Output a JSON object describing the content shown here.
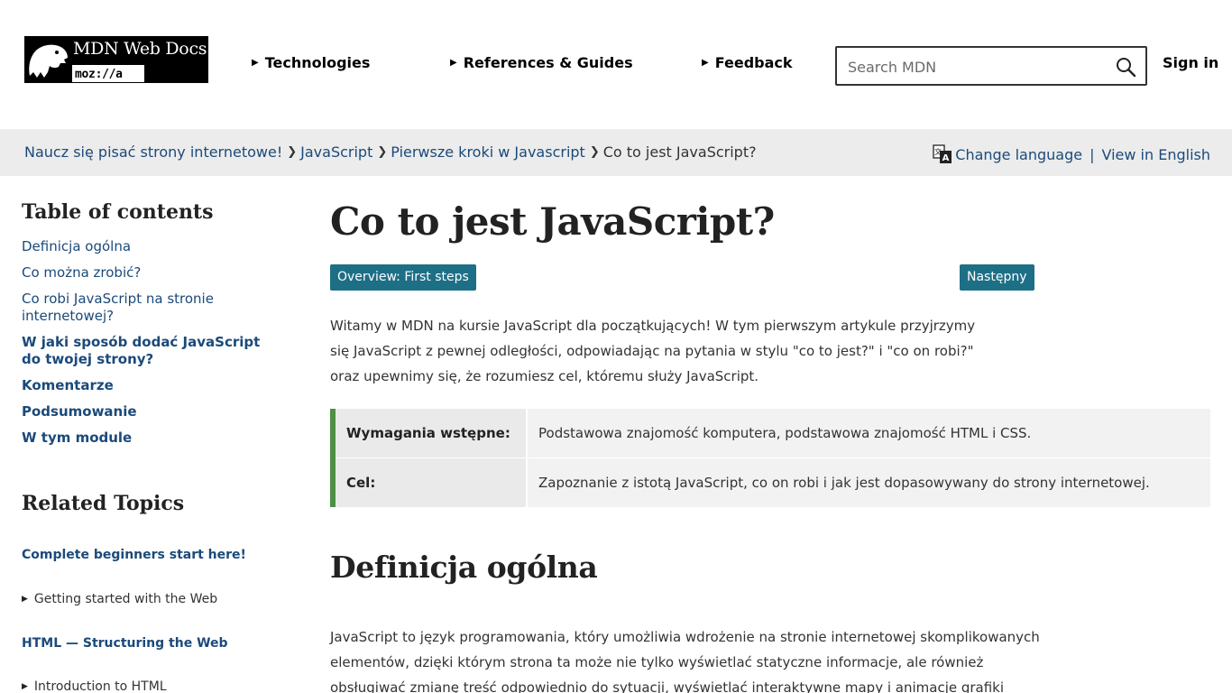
{
  "header": {
    "logo_title": "MDN Web Docs",
    "logo_sub": "moz://a",
    "nav": [
      {
        "label": "Technologies"
      },
      {
        "label": "References & Guides"
      },
      {
        "label": "Feedback"
      }
    ],
    "search_placeholder": "Search MDN",
    "signin_label": "Sign in"
  },
  "breadcrumbs": {
    "items": [
      {
        "label": "Naucz się pisać strony internetowe!"
      },
      {
        "label": "JavaScript"
      },
      {
        "label": "Pierwsze kroki w Javascript"
      }
    ],
    "current": "Co to jest JavaScript?",
    "change_language": "Change language",
    "separator": "|",
    "view_english": "View in English"
  },
  "sidebar": {
    "toc_title": "Table of contents",
    "toc": [
      {
        "label": "Definicja ogólna",
        "bold": false
      },
      {
        "label": "Co można zrobić?",
        "bold": false
      },
      {
        "label": "Co robi JavaScript na stronie internetowej?",
        "bold": false
      },
      {
        "label": "W jaki sposób dodać JavaScript do twojej strony?",
        "bold": true
      },
      {
        "label": "Komentarze",
        "bold": true
      },
      {
        "label": "Podsumowanie",
        "bold": true
      },
      {
        "label": "W tym module",
        "bold": true
      }
    ],
    "related_title": "Related Topics",
    "related": [
      {
        "label": "Complete beginners start here!",
        "kind": "link"
      },
      {
        "label": "Getting started with the Web",
        "kind": "summary"
      },
      {
        "label": "HTML — Structuring the Web",
        "kind": "link"
      },
      {
        "label": "Introduction to HTML",
        "kind": "summary"
      }
    ]
  },
  "main": {
    "title": "Co to jest JavaScript?",
    "overview_button": "Overview: First steps",
    "next_button": "Następny",
    "intro": "Witamy w MDN na kursie JavaScript dla początkujących! W tym pierwszym artykule przyjrzymy się JavaScript z pewnej odległości, odpowiadając na pytania w stylu \"co to jest?\" i \"co on robi?\" oraz upewnimy się, że rozumiesz cel, któremu służy JavaScript.",
    "prereq": [
      {
        "label": "Wymagania wstępne:",
        "value": "Podstawowa znajomość komputera, podstawowa znajomość HTML i CSS."
      },
      {
        "label": "Cel:",
        "value": "Zapoznanie z istotą JavaScript, co on robi i jak jest dopasowywany do strony internetowej."
      }
    ],
    "section_title": "Definicja ogólna",
    "section_text": "JavaScript to język programowania, który umożliwia wdrożenie na stronie internetowej skomplikowanych elementów, dzięki którym strona ta może nie tylko wyświetlać statyczne informacje, ale również obsługiwać zmianę treść odpowiednio do sytuacji, wyświetlać interaktywne mapy i animacje grafiki"
  },
  "colors": {
    "link": "#1b4a7a",
    "button": "#1d6f86",
    "prereq_border": "#4d8f45",
    "breadcrumb_bg": "#ececec"
  },
  "icons": {
    "logo": "dinosaur-logo-icon",
    "search": "search-icon",
    "language": "language-icon",
    "nav_arrow": "triangle-right-icon"
  }
}
